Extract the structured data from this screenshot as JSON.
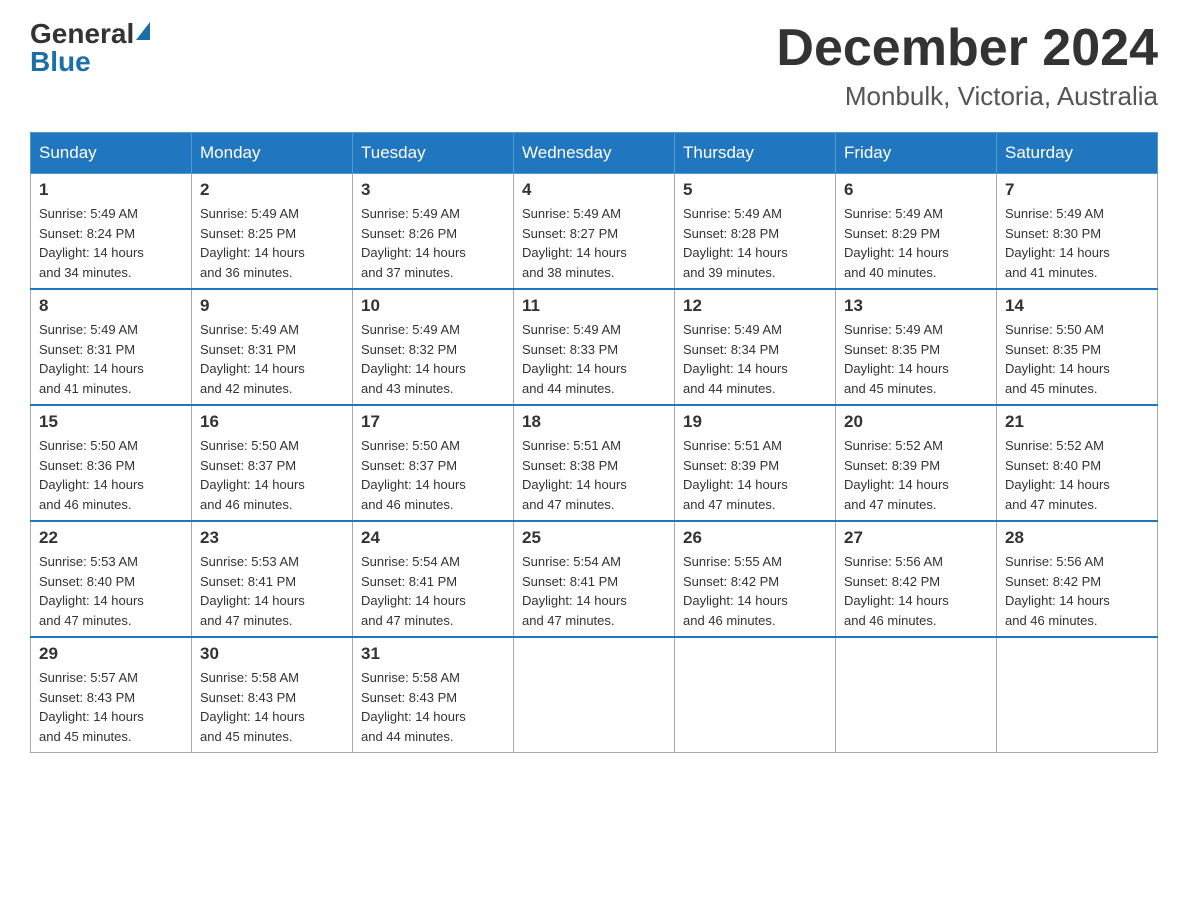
{
  "logo": {
    "general": "General",
    "blue": "Blue"
  },
  "title": "December 2024",
  "location": "Monbulk, Victoria, Australia",
  "days_of_week": [
    "Sunday",
    "Monday",
    "Tuesday",
    "Wednesday",
    "Thursday",
    "Friday",
    "Saturday"
  ],
  "weeks": [
    [
      {
        "day": "1",
        "sunrise": "5:49 AM",
        "sunset": "8:24 PM",
        "daylight": "14 hours and 34 minutes."
      },
      {
        "day": "2",
        "sunrise": "5:49 AM",
        "sunset": "8:25 PM",
        "daylight": "14 hours and 36 minutes."
      },
      {
        "day": "3",
        "sunrise": "5:49 AM",
        "sunset": "8:26 PM",
        "daylight": "14 hours and 37 minutes."
      },
      {
        "day": "4",
        "sunrise": "5:49 AM",
        "sunset": "8:27 PM",
        "daylight": "14 hours and 38 minutes."
      },
      {
        "day": "5",
        "sunrise": "5:49 AM",
        "sunset": "8:28 PM",
        "daylight": "14 hours and 39 minutes."
      },
      {
        "day": "6",
        "sunrise": "5:49 AM",
        "sunset": "8:29 PM",
        "daylight": "14 hours and 40 minutes."
      },
      {
        "day": "7",
        "sunrise": "5:49 AM",
        "sunset": "8:30 PM",
        "daylight": "14 hours and 41 minutes."
      }
    ],
    [
      {
        "day": "8",
        "sunrise": "5:49 AM",
        "sunset": "8:31 PM",
        "daylight": "14 hours and 41 minutes."
      },
      {
        "day": "9",
        "sunrise": "5:49 AM",
        "sunset": "8:31 PM",
        "daylight": "14 hours and 42 minutes."
      },
      {
        "day": "10",
        "sunrise": "5:49 AM",
        "sunset": "8:32 PM",
        "daylight": "14 hours and 43 minutes."
      },
      {
        "day": "11",
        "sunrise": "5:49 AM",
        "sunset": "8:33 PM",
        "daylight": "14 hours and 44 minutes."
      },
      {
        "day": "12",
        "sunrise": "5:49 AM",
        "sunset": "8:34 PM",
        "daylight": "14 hours and 44 minutes."
      },
      {
        "day": "13",
        "sunrise": "5:49 AM",
        "sunset": "8:35 PM",
        "daylight": "14 hours and 45 minutes."
      },
      {
        "day": "14",
        "sunrise": "5:50 AM",
        "sunset": "8:35 PM",
        "daylight": "14 hours and 45 minutes."
      }
    ],
    [
      {
        "day": "15",
        "sunrise": "5:50 AM",
        "sunset": "8:36 PM",
        "daylight": "14 hours and 46 minutes."
      },
      {
        "day": "16",
        "sunrise": "5:50 AM",
        "sunset": "8:37 PM",
        "daylight": "14 hours and 46 minutes."
      },
      {
        "day": "17",
        "sunrise": "5:50 AM",
        "sunset": "8:37 PM",
        "daylight": "14 hours and 46 minutes."
      },
      {
        "day": "18",
        "sunrise": "5:51 AM",
        "sunset": "8:38 PM",
        "daylight": "14 hours and 47 minutes."
      },
      {
        "day": "19",
        "sunrise": "5:51 AM",
        "sunset": "8:39 PM",
        "daylight": "14 hours and 47 minutes."
      },
      {
        "day": "20",
        "sunrise": "5:52 AM",
        "sunset": "8:39 PM",
        "daylight": "14 hours and 47 minutes."
      },
      {
        "day": "21",
        "sunrise": "5:52 AM",
        "sunset": "8:40 PM",
        "daylight": "14 hours and 47 minutes."
      }
    ],
    [
      {
        "day": "22",
        "sunrise": "5:53 AM",
        "sunset": "8:40 PM",
        "daylight": "14 hours and 47 minutes."
      },
      {
        "day": "23",
        "sunrise": "5:53 AM",
        "sunset": "8:41 PM",
        "daylight": "14 hours and 47 minutes."
      },
      {
        "day": "24",
        "sunrise": "5:54 AM",
        "sunset": "8:41 PM",
        "daylight": "14 hours and 47 minutes."
      },
      {
        "day": "25",
        "sunrise": "5:54 AM",
        "sunset": "8:41 PM",
        "daylight": "14 hours and 47 minutes."
      },
      {
        "day": "26",
        "sunrise": "5:55 AM",
        "sunset": "8:42 PM",
        "daylight": "14 hours and 46 minutes."
      },
      {
        "day": "27",
        "sunrise": "5:56 AM",
        "sunset": "8:42 PM",
        "daylight": "14 hours and 46 minutes."
      },
      {
        "day": "28",
        "sunrise": "5:56 AM",
        "sunset": "8:42 PM",
        "daylight": "14 hours and 46 minutes."
      }
    ],
    [
      {
        "day": "29",
        "sunrise": "5:57 AM",
        "sunset": "8:43 PM",
        "daylight": "14 hours and 45 minutes."
      },
      {
        "day": "30",
        "sunrise": "5:58 AM",
        "sunset": "8:43 PM",
        "daylight": "14 hours and 45 minutes."
      },
      {
        "day": "31",
        "sunrise": "5:58 AM",
        "sunset": "8:43 PM",
        "daylight": "14 hours and 44 minutes."
      },
      null,
      null,
      null,
      null
    ]
  ],
  "labels": {
    "sunrise": "Sunrise:",
    "sunset": "Sunset:",
    "daylight": "Daylight:"
  }
}
